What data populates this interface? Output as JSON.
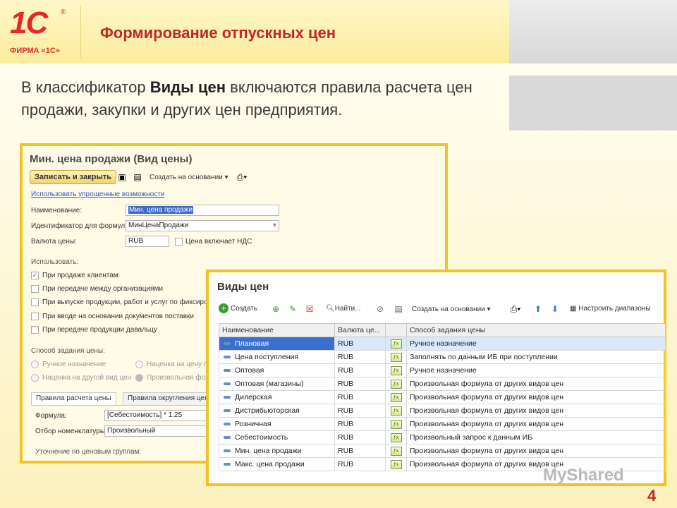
{
  "header": {
    "logo_text": "1С",
    "logo_sub": "ФИРМА «1С»",
    "title": "Формирование отпускных цен"
  },
  "lead": {
    "part1": "В классификатор ",
    "bold": "Виды цен",
    "part2": " включаются правила расчета цен продажи, закупки и других цен предприятия."
  },
  "form1": {
    "title": "Мин. цена продажи (Вид цены)",
    "save_close": "Записать и закрыть",
    "create_based": "Создать на основании",
    "simple_link": "Использовать упрощенные возможности",
    "name_label": "Наименование:",
    "name_value": "Мин. цена продажи",
    "id_label": "Идентификатор для формул:",
    "id_value": "МинЦенаПродажи",
    "currency_label": "Валюта цены:",
    "currency_value": "RUB",
    "vat_label": "Цена включает НДС",
    "use_label": "Использовать:",
    "checkboxes": [
      "При продаже клиентам",
      "При передаче между организациями",
      "При выпуске продукции, работ и услуг по фиксирова",
      "При вводе на основании документов поставки",
      "При передаче продукции давальцу"
    ],
    "method_label": "Способ задания цены:",
    "radios": [
      "Ручное назначение",
      "Наценка на другой вид цен",
      "Наценка на цену по",
      "Произвольная форм"
    ],
    "tabs": [
      "Правила расчета цены",
      "Правила округления цен"
    ],
    "formula_label": "Формула:",
    "formula_value": "[Себестоимость] * 1.25",
    "filter_label": "Отбор номенклатуры:",
    "filter_value": "Произвольный",
    "refine_label": "Уточнение по ценовым группам:"
  },
  "form2": {
    "title": "Виды цен",
    "toolbar": {
      "create": "Создать",
      "find": "Найти...",
      "create_based": "Создать на основании",
      "ranges": "Настроить диапазоны"
    },
    "columns": [
      "Наименование",
      "Валюта це...",
      "",
      "Способ задания цены"
    ],
    "rows": [
      {
        "name": "Плановая",
        "currency": "RUB",
        "method": "Ручное назначение"
      },
      {
        "name": "Цена поступления",
        "currency": "RUB",
        "method": "Заполнять по данным ИБ при поступлении"
      },
      {
        "name": "Оптовая",
        "currency": "RUB",
        "method": "Ручное назначение"
      },
      {
        "name": "Оптовая (магазины)",
        "currency": "RUB",
        "method": "Произвольная формула от других видов цен"
      },
      {
        "name": "Дилерская",
        "currency": "RUB",
        "method": "Произвольная формула от других видов цен"
      },
      {
        "name": "Дистрибьюторская",
        "currency": "RUB",
        "method": "Произвольная формула от других видов цен"
      },
      {
        "name": "Розничная",
        "currency": "RUB",
        "method": "Произвольная формула от других видов цен"
      },
      {
        "name": "Себестоимость",
        "currency": "RUB",
        "method": "Произвольный запрос к данным ИБ"
      },
      {
        "name": "Мин. цена продажи",
        "currency": "RUB",
        "method": "Произвольная формула от других видов цен"
      },
      {
        "name": "Макс. цена продажи",
        "currency": "RUB",
        "method": "Произвольная формула от других видов цен"
      }
    ]
  },
  "watermark": "MyShared",
  "page_number": "4"
}
